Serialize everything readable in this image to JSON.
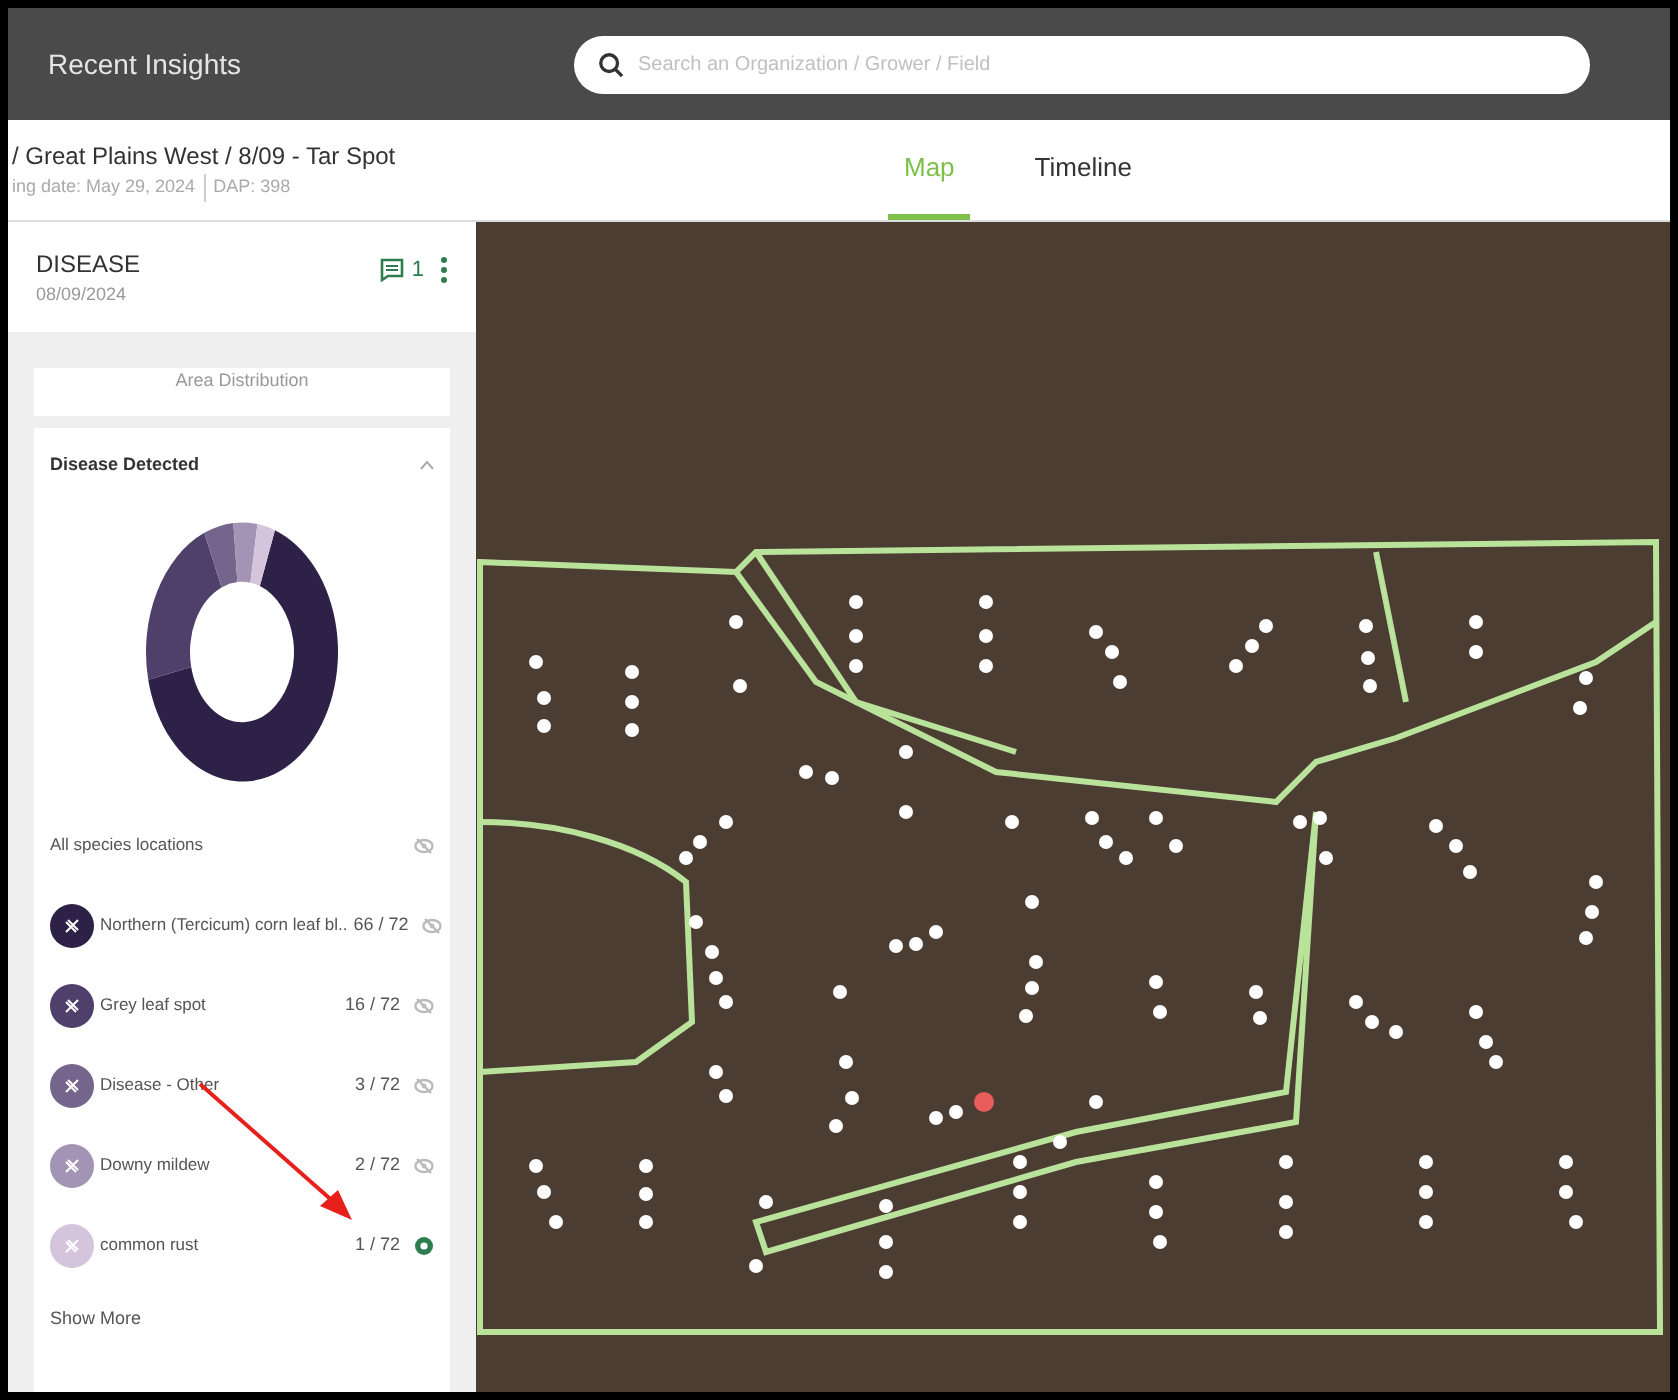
{
  "header": {
    "title": "Recent Insights",
    "search": {
      "placeholder": "Search an Organization / Grower / Field"
    }
  },
  "breadcrumb": {
    "path": "/ Great Plains West / 8/09 - Tar Spot",
    "planting": "ing date: May 29, 2024",
    "dap": "DAP: 398"
  },
  "tabs": [
    {
      "label": "Map",
      "selected": true
    },
    {
      "label": "Timeline",
      "selected": false
    }
  ],
  "panel": {
    "title": "DISEASE",
    "date": "08/09/2024",
    "notes_count": "1",
    "area_distribution": "Area Distribution",
    "disease_detected": {
      "title": "Disease Detected",
      "expanded": true,
      "all_locations": {
        "label": "All species locations",
        "visible": false
      },
      "species": [
        {
          "name": "Northern (Tercicum) corn leaf bl..",
          "count": "66 / 72",
          "color": "#2d2147",
          "visible": false
        },
        {
          "name": "Grey leaf spot",
          "count": "16 / 72",
          "color": "#4f3f6b",
          "visible": false
        },
        {
          "name": "Disease - Other",
          "count": "3 / 72",
          "color": "#75648c",
          "visible": false
        },
        {
          "name": "Downy mildew",
          "count": "2 / 72",
          "color": "#a394b5",
          "visible": false
        },
        {
          "name": "common rust",
          "count": "1 / 72",
          "color": "#d4c5dc",
          "visible": true
        }
      ],
      "show_more": "Show More"
    }
  }
}
